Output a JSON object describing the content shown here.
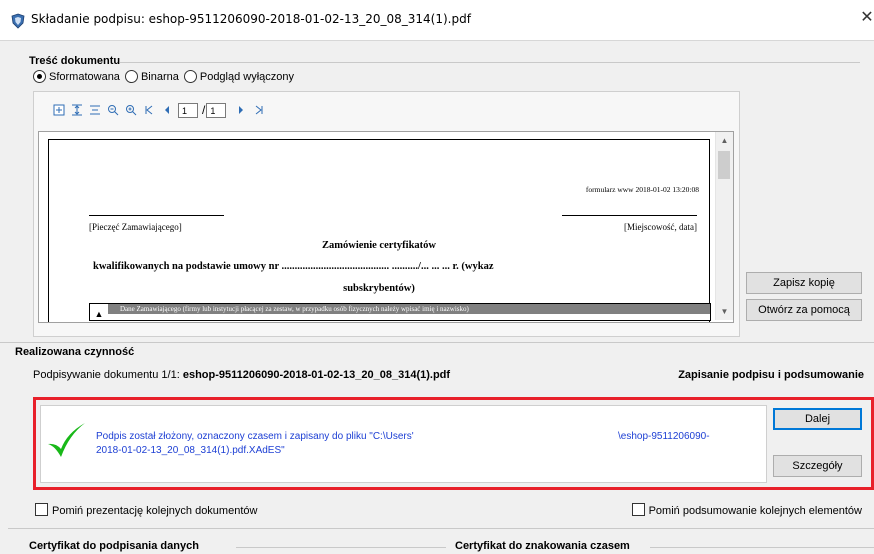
{
  "window": {
    "title": "Składanie podpisu: eshop-9511206090-2018-01-02-13_20_08_314(1).pdf",
    "close_glyph": "✕"
  },
  "content_group": {
    "title": "Treść dokumentu",
    "radios": [
      {
        "label": "Sformatowana",
        "checked": true
      },
      {
        "label": "Binarna",
        "checked": false
      },
      {
        "label": "Podgląd wyłączony",
        "checked": false
      }
    ]
  },
  "toolbar": {
    "icons": [
      "fit-page-icon",
      "fit-width-icon",
      "fit-height-icon",
      "zoom-out-icon",
      "zoom-in-icon",
      "first-page-icon",
      "prev-page-icon",
      "next-page-icon",
      "last-page-icon"
    ],
    "page_current": "1",
    "page_total": "1"
  },
  "document": {
    "header_right": "formularz www 2018-01-02 13:20:08",
    "stamp_label": "[Pieczęć Zamawiającego]",
    "place_label": "[Miejscowość, data]",
    "heading_line1": "Zamówienie certyfikatów",
    "heading_line2": "kwalifikowanych na podstawie umowy nr ......................................... ........../... ... ... r. (wykaz",
    "heading_line3": "subskrybentów)",
    "table_marker": "▲",
    "table_bar_text": "Dane Zamawiającego (firmy lub instytucji płacącej za zestaw, w przypadku osób fizycznych należy wpisać imię i nazwisko)"
  },
  "side_buttons": {
    "save_copy": "Zapisz kopię",
    "open_with": "Otwórz za pomocą"
  },
  "action_group": {
    "title": "Realizowana czynność",
    "signing_prefix": "Podpisywanie dokumentu 1/1: ",
    "signing_file": "eshop-9511206090-2018-01-02-13_20_08_314(1).pdf",
    "stage": "Zapisanie podpisu i podsumowanie"
  },
  "status": {
    "line1_left": "Podpis został złożony, oznaczony czasem i zapisany do pliku \"C:\\Users'",
    "line1_right": "\\eshop-9511206090-",
    "line2": "2018-01-02-13_20_08_314(1).pdf.XAdES\"",
    "colors": {
      "text": "#1d3fd4",
      "check": "#18b818",
      "frame": "#e8202a"
    }
  },
  "buttons": {
    "next": "Dalej",
    "details": "Szczegóły"
  },
  "checkboxes": {
    "skip_presentation": "Pomiń prezentację kolejnych dokumentów",
    "skip_summary": "Pomiń podsumowanie kolejnych elementów"
  },
  "bottom_groups": {
    "cert_sign": "Certyfikat do podpisania danych",
    "cert_timestamp": "Certyfikat do znakowania czasem"
  }
}
